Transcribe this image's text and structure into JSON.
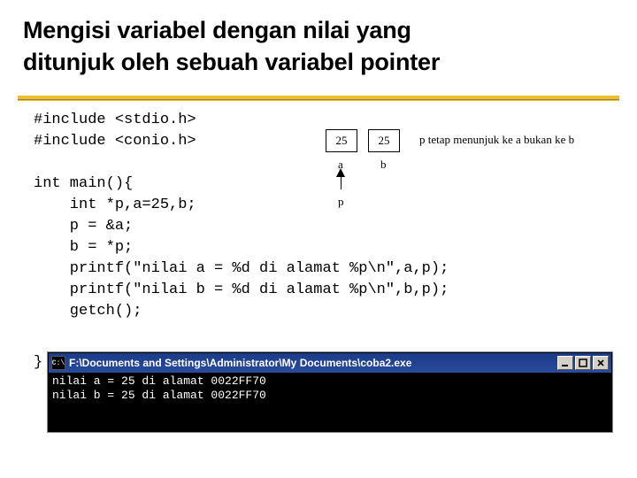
{
  "title_line1": "Mengisi variabel dengan nilai yang",
  "title_line2": "ditunjuk oleh sebuah variabel pointer",
  "code_block": "#include <stdio.h>\n#include <conio.h>\n\nint main(){\n    int *p,a=25,b;\n    p = &a;\n    b = *p;\n    printf(\"nilai a = %d di alamat %p\\n\",a,p);\n    printf(\"nilai b = %d di alamat %p\\n\",b,p);\n    getch();",
  "closing_brace": "}",
  "diagram": {
    "val_a": "25",
    "val_b": "25",
    "label_a": "a",
    "label_b": "b",
    "label_p": "p",
    "note": "p tetap menunjuk ke a bukan ke b"
  },
  "console": {
    "icon_text": "C:\\",
    "title": "F:\\Documents and Settings\\Administrator\\My Documents\\coba2.exe",
    "output": "nilai a = 25 di alamat 0022FF70\nnilai b = 25 di alamat 0022FF70"
  }
}
